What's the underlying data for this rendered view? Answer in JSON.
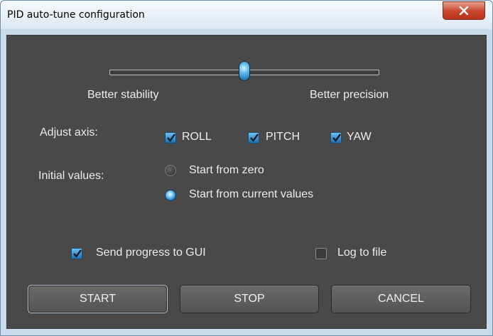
{
  "window": {
    "title": "PID auto-tune configuration"
  },
  "slider": {
    "left_label": "Better stability",
    "right_label": "Better precision",
    "value": 0.5
  },
  "axis": {
    "label": "Adjust axis:",
    "options": [
      {
        "label": "ROLL",
        "checked": true
      },
      {
        "label": "PITCH",
        "checked": true
      },
      {
        "label": "YAW",
        "checked": true
      }
    ]
  },
  "initial": {
    "label": "Initial values:",
    "options": [
      {
        "label": "Start from zero",
        "selected": false
      },
      {
        "label": "Start from current values",
        "selected": true
      }
    ]
  },
  "options": {
    "send_progress": {
      "label": "Send progress to GUI",
      "checked": true
    },
    "log_to_file": {
      "label": "Log to file",
      "checked": false
    }
  },
  "buttons": {
    "start": "START",
    "stop": "STOP",
    "cancel": "CANCEL"
  },
  "colors": {
    "panel": "#494949",
    "accent": "#2f8fd6",
    "titlebar": "#dce7f2",
    "close": "#c7432a"
  }
}
